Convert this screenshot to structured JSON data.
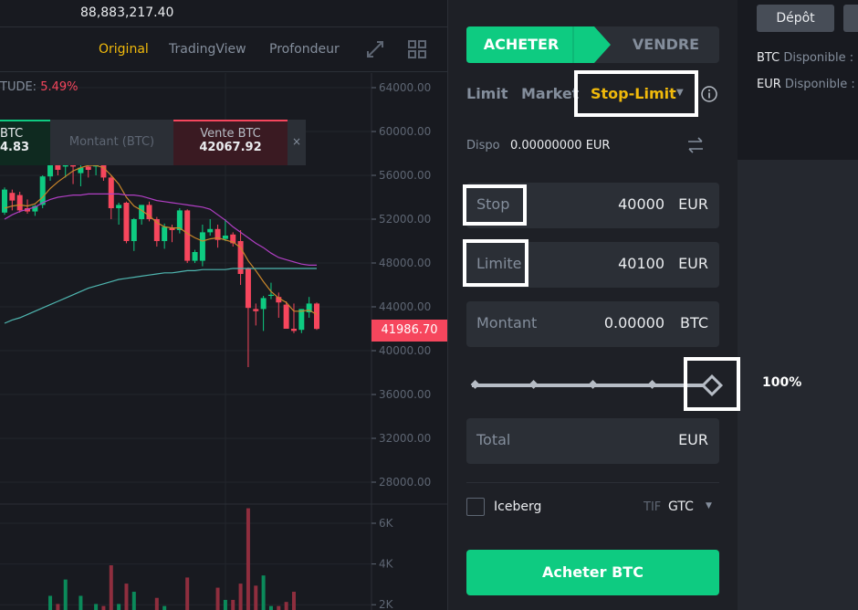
{
  "header": {
    "total_value": "88,883,217.40"
  },
  "chart_toolbar": {
    "tabs": [
      {
        "label": "Original",
        "active": true
      },
      {
        "label": "TradingView",
        "active": false
      },
      {
        "label": "Profondeur",
        "active": false
      }
    ],
    "icons": [
      "expand-icon",
      "grid-layout-icon"
    ]
  },
  "chart_info": {
    "label": "TUDE:",
    "value": "5.49%"
  },
  "quick_trade": {
    "buy_label": "BTC",
    "buy_price": "4.83",
    "amount_placeholder": "Montant (BTC)",
    "sell_label": "Vente BTC",
    "sell_price": "42067.92",
    "close": "×"
  },
  "colors": {
    "up": "#0ecb81",
    "down": "#f6465d",
    "accent": "#f0b90b",
    "ma7": "#c9862a",
    "ma25": "#b13fc4",
    "ma99": "#4fb6b0"
  },
  "chart_data": {
    "type": "candlestick",
    "price_ticks": [
      "64000.00",
      "60000.00",
      "56000.00",
      "52000.00",
      "48000.00",
      "44000.00",
      "40000.00",
      "36000.00",
      "32000.00",
      "28000.00"
    ],
    "volume_ticks": [
      "6K",
      "4K",
      "2K"
    ],
    "last_price": "41986.70",
    "candles": [
      [
        52600,
        54900,
        52400,
        54700
      ],
      [
        54400,
        54700,
        52800,
        53700
      ],
      [
        54200,
        54500,
        52600,
        52800
      ],
      [
        53000,
        53800,
        52500,
        52700
      ],
      [
        52700,
        53300,
        52300,
        53200
      ],
      [
        53300,
        56000,
        53000,
        55900
      ],
      [
        55900,
        60000,
        55500,
        59000
      ],
      [
        58000,
        58500,
        56000,
        56500
      ],
      [
        56800,
        57500,
        55800,
        57000
      ],
      [
        57000,
        57300,
        55200,
        56800
      ],
      [
        56200,
        57200,
        55000,
        56700
      ],
      [
        56800,
        57300,
        55800,
        56500
      ],
      [
        56800,
        57500,
        56000,
        57300
      ],
      [
        57100,
        57300,
        55500,
        55800
      ],
      [
        55800,
        56000,
        52000,
        53000
      ],
      [
        53000,
        53500,
        51500,
        53300
      ],
      [
        53500,
        53600,
        49800,
        50000
      ],
      [
        50000,
        52100,
        49100,
        52000
      ],
      [
        52000,
        53300,
        51500,
        53300
      ],
      [
        53300,
        53600,
        51800,
        52000
      ],
      [
        52000,
        52200,
        49500,
        50000
      ],
      [
        50000,
        51600,
        49300,
        51300
      ],
      [
        51200,
        51500,
        49900,
        51000
      ],
      [
        51000,
        53000,
        50700,
        52800
      ],
      [
        52800,
        52900,
        48000,
        48200
      ],
      [
        48200,
        49200,
        48000,
        49000
      ],
      [
        48200,
        51500,
        47700,
        50800
      ],
      [
        50800,
        52000,
        50500,
        51100
      ],
      [
        51100,
        51500,
        49400,
        50100
      ],
      [
        50200,
        52000,
        50000,
        50500
      ],
      [
        50600,
        50800,
        49500,
        49800
      ],
      [
        50000,
        51000,
        46000,
        47000
      ],
      [
        47500,
        47600,
        38500,
        43900
      ],
      [
        43800,
        44300,
        42300,
        43600
      ],
      [
        43800,
        45000,
        41800,
        44800
      ],
      [
        45000,
        46200,
        44700,
        45100
      ],
      [
        44900,
        45300,
        43000,
        44400
      ],
      [
        44200,
        44500,
        42000,
        42000
      ],
      [
        42000,
        44300,
        41600,
        41800
      ],
      [
        41900,
        43800,
        41600,
        43800
      ],
      [
        43500,
        44900,
        43000,
        44300
      ],
      [
        44300,
        44400,
        41900,
        41987
      ]
    ],
    "volumes": [
      0.8,
      0.6,
      0.9,
      0.5,
      0.7,
      1.2,
      2.4,
      2.0,
      3.2,
      1.2,
      2.4,
      1.2,
      2.0,
      1.9,
      3.9,
      2.0,
      3.0,
      2.6,
      1.6,
      1.4,
      2.3,
      1.9,
      1.2,
      1.5,
      3.3,
      1.5,
      1.6,
      1.5,
      2.8,
      2.2,
      2.2,
      3.0,
      6.7,
      2.9,
      3.4,
      1.9,
      1.9,
      2.1,
      2.6,
      1.2,
      1.0,
      1.4
    ],
    "ma7": [
      53000,
      53200,
      53300,
      53200,
      53400,
      54000,
      54800,
      55400,
      55900,
      56400,
      56700,
      56900,
      56900,
      56700,
      56000,
      55200,
      54000,
      53200,
      52800,
      52300,
      51700,
      51300,
      51200,
      51200,
      50700,
      50300,
      50000,
      50200,
      50300,
      50100,
      49900,
      49400,
      48200,
      47300,
      46300,
      45400,
      44800,
      44400,
      43600,
      43600,
      43700,
      43300
    ],
    "ma25": [
      52000,
      52400,
      52700,
      52900,
      53100,
      53500,
      53800,
      54000,
      54100,
      54200,
      54200,
      54300,
      54300,
      54300,
      54300,
      54300,
      54200,
      54200,
      54100,
      53900,
      53700,
      53600,
      53500,
      53400,
      53300,
      53200,
      53100,
      52900,
      52400,
      51900,
      51300,
      50800,
      50300,
      49800,
      49400,
      48900,
      48500,
      48300,
      48100,
      47900,
      47800,
      47800
    ],
    "ma99": [
      42500,
      42800,
      43000,
      43300,
      43600,
      43900,
      44200,
      44500,
      44800,
      45100,
      45400,
      45700,
      45900,
      46100,
      46300,
      46500,
      46600,
      46700,
      46800,
      46900,
      47000,
      47100,
      47100,
      47200,
      47300,
      47300,
      47400,
      47400,
      47400,
      47400,
      47500,
      47500,
      47500,
      47500,
      47500,
      47500,
      47500,
      47500,
      47500,
      47500,
      47500,
      47500
    ]
  },
  "order_form": {
    "buy_tab": "ACHETER",
    "sell_tab": "VENDRE",
    "order_types": [
      "Limit",
      "Market",
      "Stop-Limit"
    ],
    "active_type": "Stop-Limit",
    "available_label": "Dispo",
    "available_value": "0.00000000 EUR",
    "stop": {
      "label": "Stop",
      "value": "40000",
      "unit": "EUR"
    },
    "limit": {
      "label": "Limite",
      "value": "40100",
      "unit": "EUR"
    },
    "amount": {
      "label": "Montant",
      "value": "0.00000",
      "unit": "BTC"
    },
    "slider_percent": 100,
    "slider_label": "100%",
    "total": {
      "label": "Total",
      "value": "",
      "unit": "EUR"
    },
    "iceberg_label": "Iceberg",
    "iceberg_checked": false,
    "tif_label": "TIF",
    "tif_value": "GTC",
    "submit": "Acheter BTC"
  },
  "wallet": {
    "deposit": "Dépôt",
    "btc_label": "BTC",
    "eur_label": "EUR",
    "available": "Disponible :"
  }
}
